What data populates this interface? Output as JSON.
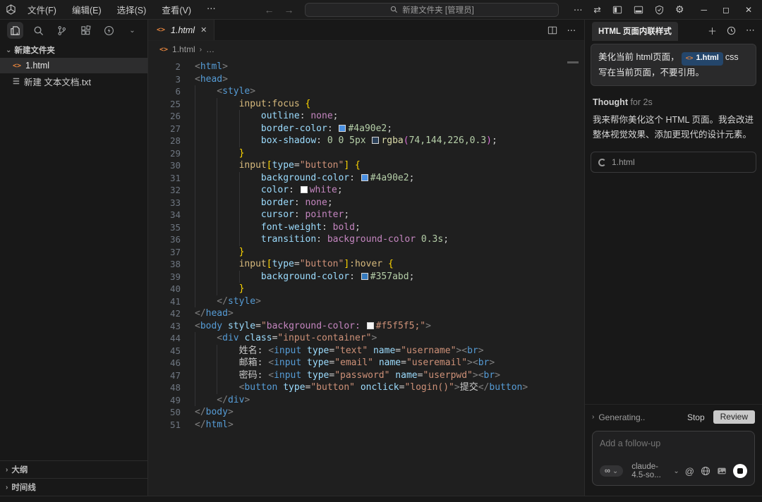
{
  "titlebar": {
    "menus": [
      "文件(F)",
      "编辑(E)",
      "选择(S)",
      "查看(V)",
      "⋯"
    ],
    "nav_back": "←",
    "nav_forward": "→",
    "search_text": "新建文件夹 [管理员]",
    "more": "⋯",
    "swap": "⇄",
    "minimize": "─",
    "maximize": "◻",
    "close": "✕"
  },
  "explorer": {
    "folder_label": "新建文件夹",
    "files": [
      {
        "name": "1.html",
        "icon": "<>",
        "type": "html",
        "active": true
      },
      {
        "name": "新建 文本文档.txt",
        "icon": "☰",
        "type": "txt",
        "active": false
      }
    ],
    "bottom_panels": [
      "大纲",
      "时间线"
    ]
  },
  "editor": {
    "tab_name": "1.html",
    "tab_close": "✕",
    "breadcrumb_icon": "<>",
    "breadcrumb_file": "1.html",
    "breadcrumb_sep": "›",
    "breadcrumb_more": "…",
    "code_lines": [
      {
        "n": 2,
        "i": 0,
        "t": [
          [
            "pun",
            "<"
          ],
          [
            "tag",
            "html"
          ],
          [
            "pun",
            ">"
          ]
        ]
      },
      {
        "n": 3,
        "i": 0,
        "t": [
          [
            "pun",
            "<"
          ],
          [
            "tag",
            "head"
          ],
          [
            "pun",
            ">"
          ]
        ]
      },
      {
        "n": 6,
        "i": 1,
        "t": [
          [
            "pun",
            "<"
          ],
          [
            "tag",
            "style"
          ],
          [
            "pun",
            ">"
          ]
        ]
      },
      {
        "n": 25,
        "i": 2,
        "t": [
          [
            "sel",
            "input:focus"
          ],
          [
            "def",
            " "
          ],
          [
            "br1",
            "{"
          ]
        ]
      },
      {
        "n": 26,
        "i": 3,
        "t": [
          [
            "prop",
            "outline"
          ],
          [
            "def",
            ": "
          ],
          [
            "val",
            "none"
          ],
          [
            "def",
            ";"
          ]
        ]
      },
      {
        "n": 27,
        "i": 3,
        "t": [
          [
            "prop",
            "border-color"
          ],
          [
            "def",
            ": "
          ],
          [
            "sw",
            "#4a90e2"
          ],
          [
            "num",
            "#4a90e2"
          ],
          [
            "def",
            ";"
          ]
        ]
      },
      {
        "n": 28,
        "i": 3,
        "t": [
          [
            "prop",
            "box-shadow"
          ],
          [
            "def",
            ": "
          ],
          [
            "num",
            "0 0 5px"
          ],
          [
            "def",
            " "
          ],
          [
            "sw",
            "rgba(74,144,226,0.3)"
          ],
          [
            "fn",
            "rgba"
          ],
          [
            "br2",
            "("
          ],
          [
            "num",
            "74,144,226,0.3"
          ],
          [
            "br2",
            ")"
          ],
          [
            "def",
            ";"
          ]
        ]
      },
      {
        "n": 29,
        "i": 2,
        "t": [
          [
            "br1",
            "}"
          ]
        ]
      },
      {
        "n": 30,
        "i": 2,
        "t": [
          [
            "sel",
            "input"
          ],
          [
            "br1",
            "["
          ],
          [
            "attr",
            "type"
          ],
          [
            "def",
            "="
          ],
          [
            "str",
            "\"button\""
          ],
          [
            "br1",
            "]"
          ],
          [
            "def",
            " "
          ],
          [
            "br1",
            "{"
          ]
        ]
      },
      {
        "n": 31,
        "i": 3,
        "t": [
          [
            "prop",
            "background-color"
          ],
          [
            "def",
            ": "
          ],
          [
            "sw",
            "#4a90e2"
          ],
          [
            "num",
            "#4a90e2"
          ],
          [
            "def",
            ";"
          ]
        ]
      },
      {
        "n": 32,
        "i": 3,
        "t": [
          [
            "prop",
            "color"
          ],
          [
            "def",
            ": "
          ],
          [
            "sw",
            "#ffffff"
          ],
          [
            "val",
            "white"
          ],
          [
            "def",
            ";"
          ]
        ]
      },
      {
        "n": 33,
        "i": 3,
        "t": [
          [
            "prop",
            "border"
          ],
          [
            "def",
            ": "
          ],
          [
            "val",
            "none"
          ],
          [
            "def",
            ";"
          ]
        ]
      },
      {
        "n": 34,
        "i": 3,
        "t": [
          [
            "prop",
            "cursor"
          ],
          [
            "def",
            ": "
          ],
          [
            "val",
            "pointer"
          ],
          [
            "def",
            ";"
          ]
        ]
      },
      {
        "n": 35,
        "i": 3,
        "t": [
          [
            "prop",
            "font-weight"
          ],
          [
            "def",
            ": "
          ],
          [
            "val",
            "bold"
          ],
          [
            "def",
            ";"
          ]
        ]
      },
      {
        "n": 36,
        "i": 3,
        "t": [
          [
            "prop",
            "transition"
          ],
          [
            "def",
            ": "
          ],
          [
            "val",
            "background-color"
          ],
          [
            "def",
            " "
          ],
          [
            "num",
            "0.3s"
          ],
          [
            "def",
            ";"
          ]
        ]
      },
      {
        "n": 37,
        "i": 2,
        "t": [
          [
            "br1",
            "}"
          ]
        ]
      },
      {
        "n": 38,
        "i": 2,
        "t": [
          [
            "sel",
            "input"
          ],
          [
            "br1",
            "["
          ],
          [
            "attr",
            "type"
          ],
          [
            "def",
            "="
          ],
          [
            "str",
            "\"button\""
          ],
          [
            "br1",
            "]"
          ],
          [
            "sel",
            ":hover"
          ],
          [
            "def",
            " "
          ],
          [
            "br1",
            "{"
          ]
        ]
      },
      {
        "n": 39,
        "i": 3,
        "t": [
          [
            "prop",
            "background-color"
          ],
          [
            "def",
            ": "
          ],
          [
            "sw",
            "#357abd"
          ],
          [
            "num",
            "#357abd"
          ],
          [
            "def",
            ";"
          ]
        ]
      },
      {
        "n": 40,
        "i": 2,
        "t": [
          [
            "br1",
            "}"
          ]
        ]
      },
      {
        "n": 41,
        "i": 1,
        "t": [
          [
            "pun",
            "</"
          ],
          [
            "tag",
            "style"
          ],
          [
            "pun",
            ">"
          ]
        ]
      },
      {
        "n": 42,
        "i": 0,
        "t": [
          [
            "pun",
            "</"
          ],
          [
            "tag",
            "head"
          ],
          [
            "pun",
            ">"
          ]
        ]
      },
      {
        "n": 43,
        "i": 0,
        "t": [
          [
            "pun",
            "<"
          ],
          [
            "tag",
            "body"
          ],
          [
            "def",
            " "
          ],
          [
            "attr",
            "style"
          ],
          [
            "def",
            "="
          ],
          [
            "str",
            "\""
          ],
          [
            "val",
            "background-color:"
          ],
          [
            "def",
            " "
          ],
          [
            "sw",
            "#f5f5f5"
          ],
          [
            "str",
            "#f5f5f5;\""
          ],
          [
            "pun",
            ">"
          ]
        ]
      },
      {
        "n": 44,
        "i": 1,
        "t": [
          [
            "pun",
            "<"
          ],
          [
            "tag",
            "div"
          ],
          [
            "def",
            " "
          ],
          [
            "attr",
            "class"
          ],
          [
            "def",
            "="
          ],
          [
            "str",
            "\"input-container\""
          ],
          [
            "pun",
            ">"
          ]
        ]
      },
      {
        "n": 45,
        "i": 2,
        "t": [
          [
            "txt",
            "姓名: "
          ],
          [
            "pun",
            "<"
          ],
          [
            "tag",
            "input"
          ],
          [
            "def",
            " "
          ],
          [
            "attr",
            "type"
          ],
          [
            "def",
            "="
          ],
          [
            "str",
            "\"text\""
          ],
          [
            "def",
            " "
          ],
          [
            "attr",
            "name"
          ],
          [
            "def",
            "="
          ],
          [
            "str",
            "\"username\""
          ],
          [
            "pun",
            "><"
          ],
          [
            "tag",
            "br"
          ],
          [
            "pun",
            ">"
          ]
        ]
      },
      {
        "n": 46,
        "i": 2,
        "t": [
          [
            "txt",
            "邮箱: "
          ],
          [
            "pun",
            "<"
          ],
          [
            "tag",
            "input"
          ],
          [
            "def",
            " "
          ],
          [
            "attr",
            "type"
          ],
          [
            "def",
            "="
          ],
          [
            "str",
            "\"email\""
          ],
          [
            "def",
            " "
          ],
          [
            "attr",
            "name"
          ],
          [
            "def",
            "="
          ],
          [
            "str",
            "\"useremail\""
          ],
          [
            "pun",
            "><"
          ],
          [
            "tag",
            "br"
          ],
          [
            "pun",
            ">"
          ]
        ]
      },
      {
        "n": 47,
        "i": 2,
        "t": [
          [
            "txt",
            "密码: "
          ],
          [
            "pun",
            "<"
          ],
          [
            "tag",
            "input"
          ],
          [
            "def",
            " "
          ],
          [
            "attr",
            "type"
          ],
          [
            "def",
            "="
          ],
          [
            "str",
            "\"password\""
          ],
          [
            "def",
            " "
          ],
          [
            "attr",
            "name"
          ],
          [
            "def",
            "="
          ],
          [
            "str",
            "\"userpwd\""
          ],
          [
            "pun",
            "><"
          ],
          [
            "tag",
            "br"
          ],
          [
            "pun",
            ">"
          ]
        ]
      },
      {
        "n": 48,
        "i": 2,
        "t": [
          [
            "pun",
            "<"
          ],
          [
            "tag",
            "button"
          ],
          [
            "def",
            " "
          ],
          [
            "attr",
            "type"
          ],
          [
            "def",
            "="
          ],
          [
            "str",
            "\"button\""
          ],
          [
            "def",
            " "
          ],
          [
            "attr",
            "onclick"
          ],
          [
            "def",
            "="
          ],
          [
            "str",
            "\"login()\""
          ],
          [
            "pun",
            ">"
          ],
          [
            "txt",
            "提交"
          ],
          [
            "pun",
            "</"
          ],
          [
            "tag",
            "button"
          ],
          [
            "pun",
            ">"
          ]
        ]
      },
      {
        "n": 49,
        "i": 1,
        "t": [
          [
            "pun",
            "</"
          ],
          [
            "tag",
            "div"
          ],
          [
            "pun",
            ">"
          ]
        ]
      },
      {
        "n": 50,
        "i": 0,
        "t": [
          [
            "pun",
            "</"
          ],
          [
            "tag",
            "body"
          ],
          [
            "pun",
            ">"
          ]
        ]
      },
      {
        "n": 51,
        "i": 0,
        "t": [
          [
            "pun",
            "</"
          ],
          [
            "tag",
            "html"
          ],
          [
            "pun",
            ">"
          ]
        ]
      }
    ]
  },
  "chat": {
    "title": "HTML 页面内联样式",
    "new_chat": "＋",
    "more": "⋯",
    "user_message": {
      "before": "美化当前 html页面，",
      "chip_icon": "<>",
      "chip_name": "1.html",
      "after": "css 写在当前页面，不要引用。"
    },
    "thought_label": "Thought",
    "thought_meta": " for 2s",
    "response": "我来帮你美化这个 HTML 页面。我会改进整体视觉效果、添加更现代的设计元素。",
    "progress_file": "1.html",
    "generating_label": "Generating..",
    "stop_label": "Stop",
    "review_label": "Review",
    "input_placeholder": "Add a follow-up",
    "mode_symbol": "∞",
    "model_name": "claude-4.5-so...",
    "at_symbol": "@"
  },
  "colors": {
    "accent_blue": "#4a90e2",
    "chip_bg": "#24466b",
    "html_icon_orange": "#e0823d"
  }
}
